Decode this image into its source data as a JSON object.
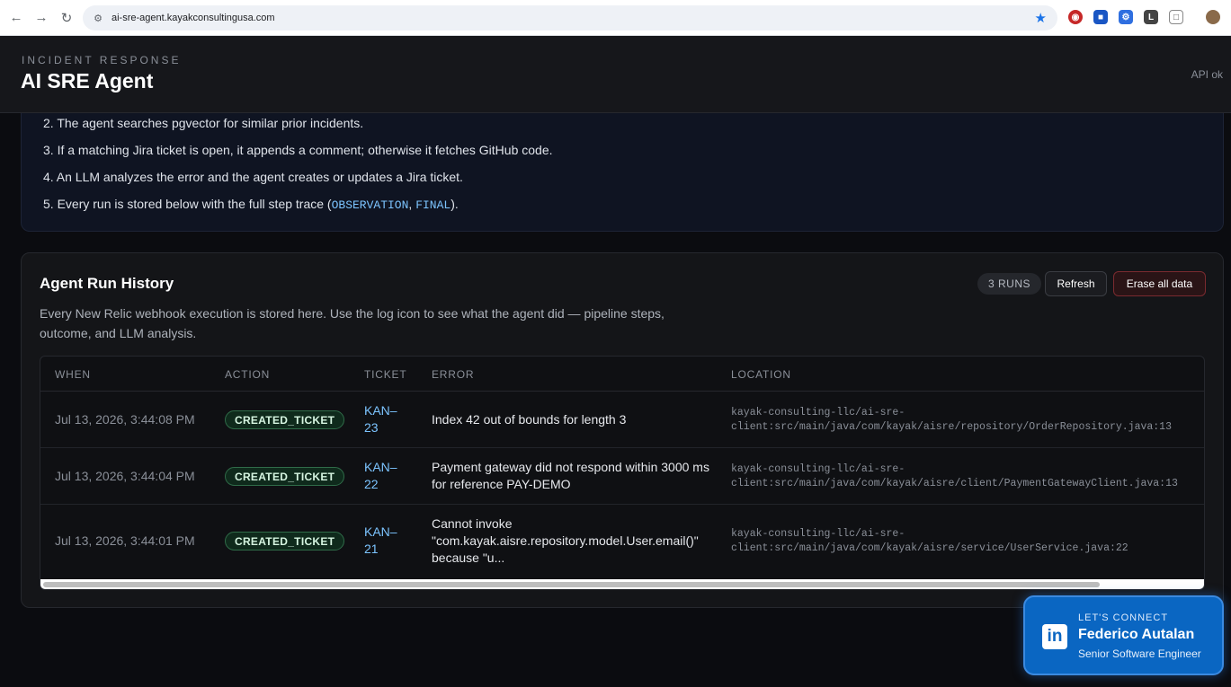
{
  "browser": {
    "url": "ai-sre-agent.kayakconsultingusa.com"
  },
  "header": {
    "eyebrow": "INCIDENT RESPONSE",
    "title": "AI SRE Agent",
    "api_status": "API ok"
  },
  "steps": [
    {
      "text": "2. The agent searches pgvector for similar prior incidents."
    },
    {
      "text": "3. If a matching Jira ticket is open, it appends a comment; otherwise it fetches GitHub code."
    },
    {
      "text": "4. An LLM analyzes the error and the agent creates or updates a Jira ticket."
    },
    {
      "prefix": "5. Every run is stored below with the full step trace (",
      "code1": "OBSERVATION",
      "sep": ", ",
      "code2": "FINAL",
      "suffix": ")."
    }
  ],
  "history": {
    "title": "Agent Run History",
    "description": "Every New Relic webhook execution is stored here. Use the log icon to see what the agent did — pipeline steps, outcome, and LLM analysis.",
    "runs_badge": "3 RUNS",
    "refresh_label": "Refresh",
    "erase_label": "Erase all data",
    "columns": [
      "WHEN",
      "ACTION",
      "TICKET",
      "ERROR",
      "LOCATION"
    ],
    "rows": [
      {
        "when": "Jul 13, 2026, 3:44:08 PM",
        "action": "CREATED_TICKET",
        "ticket_1": "KAN–",
        "ticket_2": "23",
        "error": "Index 42 out of bounds for length 3",
        "location_1": "kayak-consulting-llc/ai-sre-",
        "location_2": "client:src/main/java/com/kayak/aisre/repository/OrderRepository.java:13"
      },
      {
        "when": "Jul 13, 2026, 3:44:04 PM",
        "action": "CREATED_TICKET",
        "ticket_1": "KAN–",
        "ticket_2": "22",
        "error": "Payment gateway did not respond within 3000 ms for reference PAY-DEMO",
        "location_1": "kayak-consulting-llc/ai-sre-",
        "location_2": "client:src/main/java/com/kayak/aisre/client/PaymentGatewayClient.java:13"
      },
      {
        "when": "Jul 13, 2026, 3:44:01 PM",
        "action": "CREATED_TICKET",
        "ticket_1": "KAN–",
        "ticket_2": "21",
        "error": "Cannot invoke \"com.kayak.aisre.repository.model.User.email()\" because \"u...",
        "location_1": "kayak-consulting-llc/ai-sre-",
        "location_2": "client:src/main/java/com/kayak/aisre/service/UserService.java:22"
      }
    ]
  },
  "connect": {
    "eyebrow": "LET'S CONNECT",
    "name": "Federico Autalan",
    "role": "Senior Software Engineer",
    "logo_text": "in"
  }
}
